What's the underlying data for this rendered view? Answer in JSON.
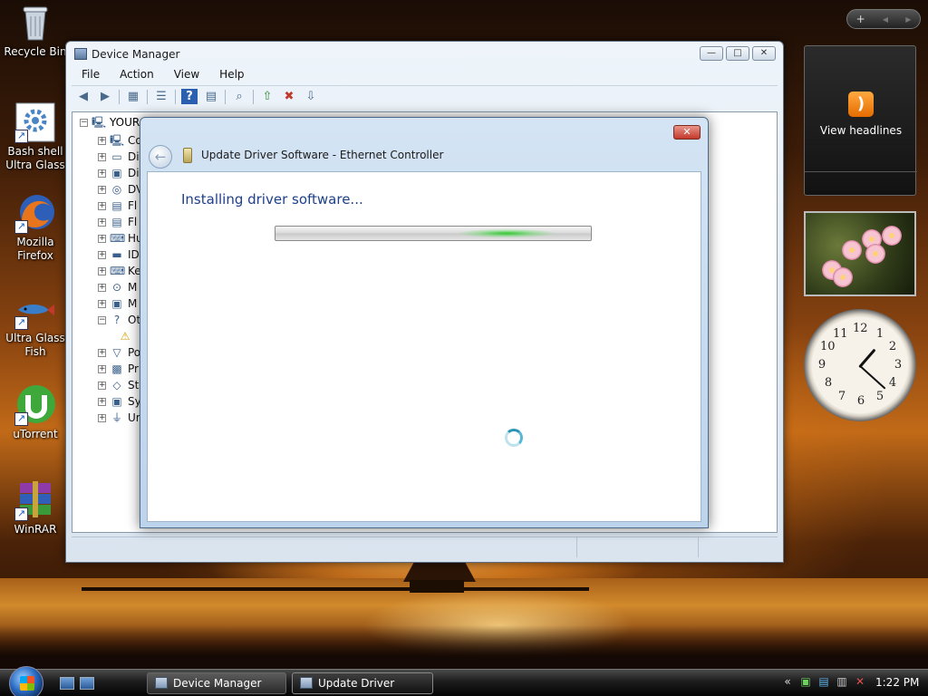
{
  "desktop": {
    "icons": [
      {
        "label": "Recycle Bin",
        "icon": "recycle-bin-icon"
      },
      {
        "label": "Bash shell Ultra Glass",
        "icon": "gear-icon"
      },
      {
        "label": "Mozilla Firefox",
        "icon": "firefox-icon"
      },
      {
        "label": "Ultra Glass Fish",
        "icon": "fish-icon"
      },
      {
        "label": "uTorrent",
        "icon": "utorrent-icon"
      },
      {
        "label": "WinRAR",
        "icon": "winrar-icon"
      }
    ]
  },
  "sidebar": {
    "add_label": "+",
    "prev_label": "◀",
    "next_label": "▶",
    "rss_gadget": {
      "label": "View headlines",
      "icon": "rss-icon"
    },
    "clock_numbers": [
      "12",
      "1",
      "2",
      "3",
      "4",
      "5",
      "6",
      "7",
      "8",
      "9",
      "10",
      "11"
    ],
    "clock_time": "1:22"
  },
  "device_manager": {
    "title": "Device Manager",
    "menu": [
      "File",
      "Action",
      "View",
      "Help"
    ],
    "window_buttons": {
      "minimize": "—",
      "maximize": "□",
      "close": "✕"
    },
    "toolbar": [
      "back-icon",
      "forward-icon",
      "properties-icon",
      "list-icon",
      "help-icon",
      "view-icon",
      "scan-icon",
      "update-driver-icon",
      "uninstall-icon",
      "enable-icon"
    ],
    "tree_root": "YOUR",
    "tree_items": [
      {
        "label": "Co",
        "icon": "computer-icon",
        "expander": "+"
      },
      {
        "label": "Di",
        "icon": "disk-drive-icon",
        "expander": "+"
      },
      {
        "label": "Di",
        "icon": "display-adapter-icon",
        "expander": "+"
      },
      {
        "label": "DV",
        "icon": "dvd-icon",
        "expander": "+"
      },
      {
        "label": "Fl",
        "icon": "floppy-icon",
        "expander": "+"
      },
      {
        "label": "Fl",
        "icon": "floppy-drive-icon",
        "expander": "+"
      },
      {
        "label": "Hu",
        "icon": "hid-icon",
        "expander": "+"
      },
      {
        "label": "ID",
        "icon": "ide-icon",
        "expander": "+"
      },
      {
        "label": "Ke",
        "icon": "keyboard-icon",
        "expander": "+"
      },
      {
        "label": "M",
        "icon": "mouse-icon",
        "expander": "+"
      },
      {
        "label": "M",
        "icon": "monitor-icon",
        "expander": "+"
      },
      {
        "label": "Ot",
        "icon": "other-devices-icon",
        "expander": "−"
      },
      {
        "label": "",
        "icon": "warning-device-icon",
        "expander": ""
      },
      {
        "label": "Po",
        "icon": "ports-icon",
        "expander": "+"
      },
      {
        "label": "Pr",
        "icon": "processor-icon",
        "expander": "+"
      },
      {
        "label": "St",
        "icon": "storage-icon",
        "expander": "+"
      },
      {
        "label": "Sy",
        "icon": "system-icon",
        "expander": "+"
      },
      {
        "label": "Ur",
        "icon": "usb-icon",
        "expander": "+"
      }
    ]
  },
  "dialog": {
    "title": "Update Driver Software - Ethernet Controller",
    "close_label": "✕",
    "back_label": "←",
    "heading": "Installing driver software...",
    "progress_indeterminate": true
  },
  "taskbar": {
    "buttons": [
      {
        "label": "Device Manager",
        "active": false
      },
      {
        "label": "Update Driver Softw...",
        "active": true
      }
    ],
    "tray_icons": [
      "chevron-icon",
      "network-icon",
      "safely-remove-icon",
      "power-icon",
      "volume-muted-icon"
    ],
    "clock": "1:22 PM"
  },
  "colors": {
    "heading": "#1e3f8a",
    "progress_glow": "#28c828",
    "close_button": "#c2382a"
  }
}
